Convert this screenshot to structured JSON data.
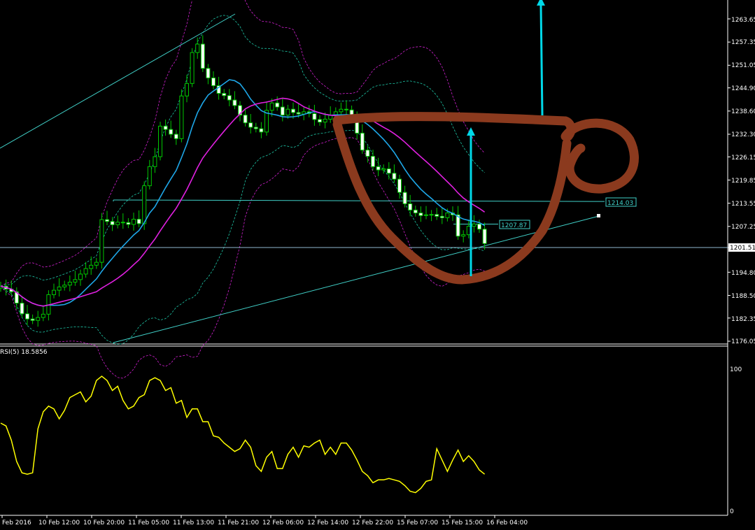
{
  "colors": {
    "background": "#000000",
    "axis": "#FFFFFF",
    "candle_up": "#00C800",
    "candle_down_body": "#FFFFFF",
    "ma_fast": "#1EA7E8",
    "ma_slow": "#E020E0",
    "bollinger": "#1EC8A8",
    "bollinger_outer": "#D020D0",
    "trendline": "#40D0C8",
    "rsi": "#FFFF00",
    "annotation_brown": "#8B3A1E",
    "annotation_arrow": "#00D8E8"
  },
  "price_axis": {
    "ticks": [
      "1263.65",
      "1257.35",
      "1251.05",
      "1244.90",
      "1238.60",
      "1232.30",
      "1226.15",
      "1219.85",
      "1213.55",
      "1207.25",
      "1201.51",
      "1194.80",
      "1188.50",
      "1182.35",
      "1176.05"
    ],
    "current_price": "1201.51"
  },
  "labels": {
    "level_upper": "1214.03",
    "level_mid": "1207.87"
  },
  "rsi": {
    "title": "RSI(5) 18.5856",
    "ticks": [
      "100",
      "0"
    ]
  },
  "time_axis": {
    "ticks": [
      "Feb 2016",
      "10 Feb 12:00",
      "10 Feb 20:00",
      "11 Feb 05:00",
      "11 Feb 13:00",
      "11 Feb 21:00",
      "12 Feb 06:00",
      "12 Feb 14:00",
      "12 Feb 22:00",
      "15 Feb 07:00",
      "15 Feb 15:00",
      "16 Feb 04:00"
    ]
  },
  "chart_data": {
    "type": "candlestick",
    "title": "",
    "price_range": [
      1176.05,
      1263.65
    ],
    "rsi_range": [
      0,
      100
    ],
    "closes": [
      1191.0,
      1190.2,
      1189.5,
      1186.4,
      1183.5,
      1182.1,
      1181.7,
      1182.5,
      1183.4,
      1188.7,
      1189.9,
      1190.8,
      1191.3,
      1192.1,
      1192.8,
      1194.3,
      1195.8,
      1196.7,
      1197.5,
      1209.1,
      1208.6,
      1207.7,
      1208.4,
      1208.3,
      1207.8,
      1209.2,
      1208.0,
      1218.3,
      1223.5,
      1226.2,
      1234.5,
      1233.6,
      1232.3,
      1231.1,
      1242.7,
      1246.1,
      1254.5,
      1256.8,
      1250.2,
      1247.6,
      1245.5,
      1243.4,
      1242.8,
      1241.6,
      1240.1,
      1237.5,
      1235.4,
      1234.2,
      1233.8,
      1232.9,
      1238.8,
      1240.8,
      1239.7,
      1237.5,
      1239.1,
      1238.2,
      1237.8,
      1238.4,
      1237.9,
      1236.3,
      1235.6,
      1236.4,
      1237.5,
      1238.4,
      1239.1,
      1238.9,
      1236.7,
      1232.6,
      1228.0,
      1226.3,
      1223.5,
      1222.6,
      1222.9,
      1221.7,
      1220.1,
      1216.5,
      1213.4,
      1211.7,
      1210.9,
      1210.2,
      1210.4,
      1210.5,
      1210.0,
      1209.6,
      1210.9,
      1210.4,
      1204.6,
      1205.0,
      1207.3,
      1207.9,
      1206.5,
      1202.6
    ],
    "rsi_values": [
      62,
      60,
      50,
      35,
      27,
      26,
      27,
      58,
      70,
      74,
      72,
      65,
      71,
      80,
      82,
      84,
      77,
      81,
      92,
      95,
      92,
      85,
      88,
      78,
      72,
      74,
      80,
      82,
      92,
      94,
      92,
      85,
      87,
      76,
      78,
      66,
      72,
      72,
      63,
      63,
      53,
      52,
      48,
      45,
      42,
      44,
      50,
      45,
      32,
      28,
      38,
      42,
      30,
      30,
      40,
      45,
      38,
      46,
      45,
      48,
      50,
      40,
      45,
      40,
      48,
      48,
      43,
      36,
      28,
      25,
      20,
      22,
      22,
      23,
      22,
      21,
      18,
      14,
      13,
      16,
      21,
      22,
      44,
      36,
      28,
      36,
      43,
      35,
      39,
      35,
      29,
      26
    ],
    "upper_level": 1214.03,
    "mid_level": 1207.87,
    "current": 1201.51
  }
}
